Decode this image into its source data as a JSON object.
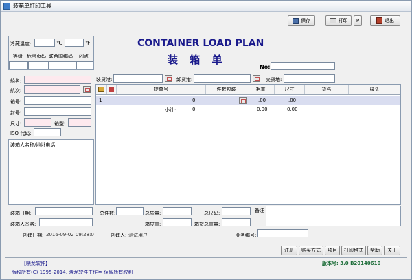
{
  "window": {
    "title": "装箱单打印工具"
  },
  "toolbar": {
    "save": "保存",
    "print": "打印",
    "p": "P",
    "exit": "退出"
  },
  "header": {
    "title_en": "CONTAINER LOAD PLAN",
    "title_cn": "装 箱 单",
    "no_label": "No:"
  },
  "left_panel": {
    "cold_temp_label": "冷藏温度:",
    "celsius": "℃",
    "fahrenheit": "℉",
    "hazard_headers": [
      "等级",
      "危险页码",
      "联合国编码",
      "闪点"
    ],
    "ship_label": "船名:",
    "voyage_label": "航次:",
    "container_no_label": "箱号:",
    "seal_no_label": "封号:",
    "size_label": "尺寸:",
    "box_type_label": "箱型:",
    "iso_label": "ISO 代码:",
    "shipper_label": "装箱人名称/地址电话:"
  },
  "ports": {
    "load": "装货港:",
    "discharge": "卸货港:",
    "delivery": "交货地:"
  },
  "grid": {
    "columns": [
      "提单号",
      "件数包装",
      "毛重",
      "尺寸",
      "货名",
      "唛头"
    ],
    "rows": [
      {
        "index": "1",
        "pieces": "0",
        "gross": ".00",
        "size": ".00"
      }
    ],
    "subtotal": {
      "label": "小计:",
      "pieces": "0",
      "gross": "0.00",
      "size": "0.00"
    }
  },
  "bottom": {
    "pack_date_label": "装箱日期:",
    "packer_sign_label": "装箱人签名:",
    "total_pieces_label": "总件数:",
    "total_weight_label": "总质量:",
    "total_size_label": "总尺码:",
    "tare_label": "箱皮重:",
    "container_total_weight_label": "箱货总重量:",
    "remark_label": "备注",
    "created_date_label": "创建日期:",
    "created_date_value": "2016-09-02 09:28:0",
    "creator_label": "创建人:",
    "creator_value": "测试用户",
    "business_no_label": "业务编号:"
  },
  "footer_buttons": [
    "注册",
    "购买方式",
    "项目",
    "打印格式",
    "帮助",
    "关于"
  ],
  "footer": {
    "brand": "【晓龙软件】",
    "version": "版本号: 3.0 B20140610",
    "copyright": "版权所有(C) 1995-2014, 晓龙软件工作室 保留所有权利"
  },
  "colors": {
    "title_blue": "#1a1a8c",
    "accent": "#3d7cc9",
    "version_green": "#1e6e3a",
    "row_highlight": "#d9ddf0"
  }
}
